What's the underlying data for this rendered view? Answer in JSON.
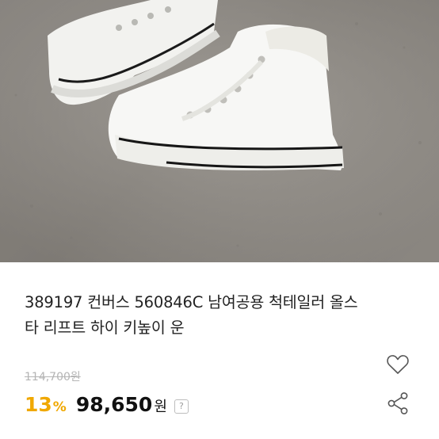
{
  "product": {
    "title_line1": "389197 컨버스 560846C 남여공용 척테일러 올스",
    "title_line2": "타 리프트 하이 키높이 운",
    "original_price": "114,700원",
    "discount_number": "13",
    "discount_symbol": "%",
    "sale_price": "98,650",
    "sale_unit": "원",
    "help_label": "?"
  },
  "image": {
    "alt": "white high-top sneakers on concrete"
  },
  "icons": {
    "wishlist": "heart-outline-icon",
    "share": "share-icon"
  },
  "colors": {
    "discount": "#f0a800",
    "price": "#111111",
    "strike": "#b5b5b5"
  }
}
